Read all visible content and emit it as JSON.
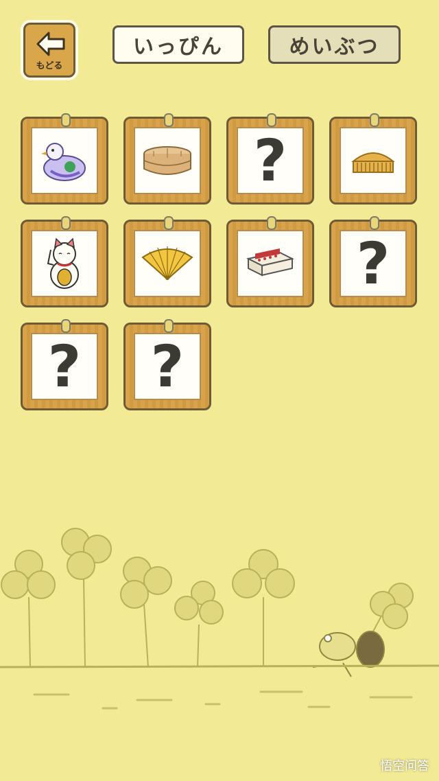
{
  "header": {
    "back_label": "もどる",
    "tabs": [
      {
        "label": "いっぴん",
        "selected": true
      },
      {
        "label": "めいぶつ",
        "selected": false
      }
    ]
  },
  "cards": [
    {
      "icon": "pigeon-whistle-icon",
      "unknown": false
    },
    {
      "icon": "bento-box-icon",
      "unknown": false
    },
    {
      "icon": "unknown-item-icon",
      "unknown": true,
      "text": "?"
    },
    {
      "icon": "comb-icon",
      "unknown": false
    },
    {
      "icon": "lucky-cat-icon",
      "unknown": false
    },
    {
      "icon": "folding-fan-icon",
      "unknown": false
    },
    {
      "icon": "matchbox-icon",
      "unknown": false
    },
    {
      "icon": "unknown-item-icon",
      "unknown": true,
      "text": "?"
    },
    {
      "icon": "unknown-item-icon",
      "unknown": true,
      "text": "?"
    },
    {
      "icon": "unknown-item-icon",
      "unknown": true,
      "text": "?"
    }
  ],
  "watermark": "悟空问答",
  "colors": {
    "background": "#f2ea95",
    "frame": "#d8a34b",
    "clover": "#d9d07a"
  }
}
